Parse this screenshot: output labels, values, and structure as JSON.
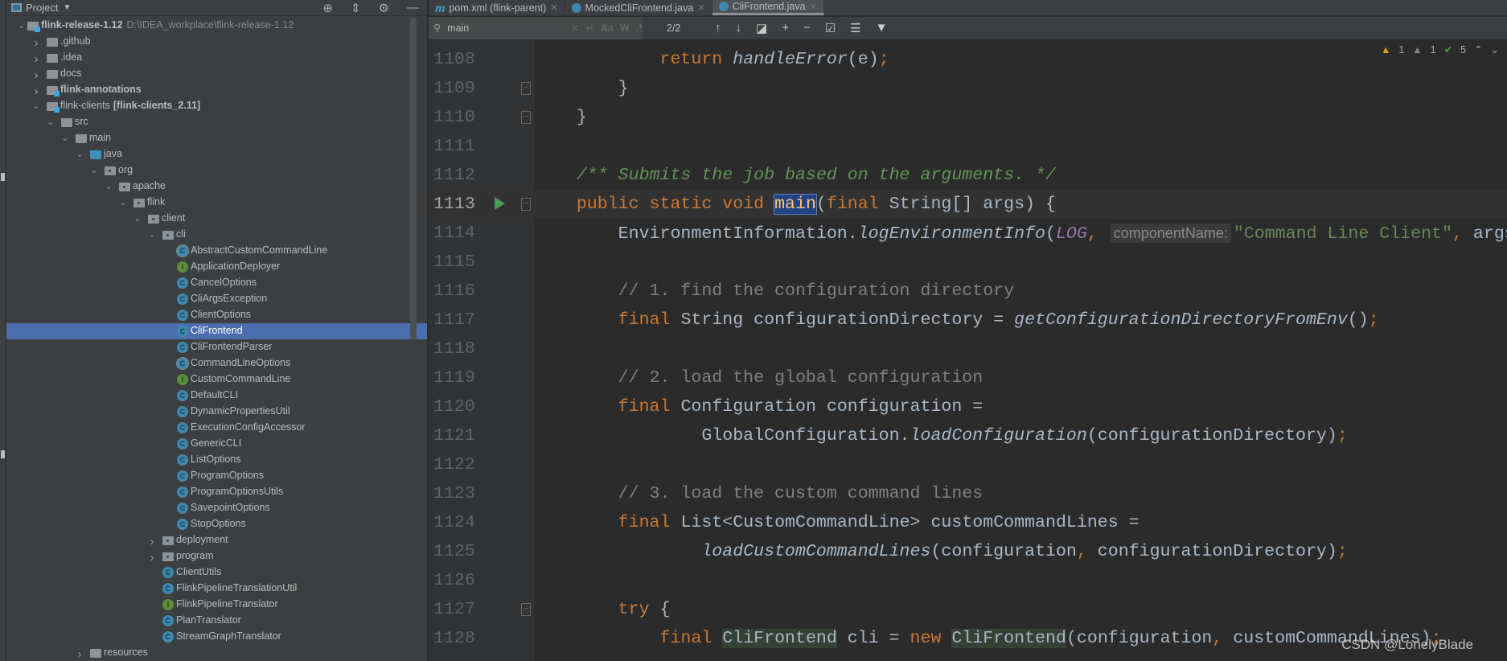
{
  "project_panel": {
    "title": "Project",
    "tools": [
      "locate-icon",
      "collapse-icon",
      "gear-icon",
      "minimize-icon"
    ],
    "tree": [
      {
        "label": "flink-release-1.12",
        "extra": "D:\\IDEA_workplace\\flink-release-1.12",
        "depth": 0,
        "kind": "module",
        "arrow": "down",
        "bold": true
      },
      {
        "label": ".github",
        "depth": 1,
        "kind": "folder",
        "arrow": "right"
      },
      {
        "label": ".idea",
        "depth": 1,
        "kind": "folder",
        "arrow": "right"
      },
      {
        "label": "docs",
        "depth": 1,
        "kind": "folder",
        "arrow": "right"
      },
      {
        "label": "flink-annotations",
        "depth": 1,
        "kind": "module",
        "arrow": "right",
        "bold": true
      },
      {
        "label": "flink-clients",
        "extra_bold": "[flink-clients_2.11]",
        "depth": 1,
        "kind": "module",
        "arrow": "down"
      },
      {
        "label": "src",
        "depth": 2,
        "kind": "folder",
        "arrow": "down"
      },
      {
        "label": "main",
        "depth": 3,
        "kind": "folder",
        "arrow": "down"
      },
      {
        "label": "java",
        "depth": 4,
        "kind": "src",
        "arrow": "down"
      },
      {
        "label": "org",
        "depth": 5,
        "kind": "pkg",
        "arrow": "down"
      },
      {
        "label": "apache",
        "depth": 6,
        "kind": "pkg",
        "arrow": "down"
      },
      {
        "label": "flink",
        "depth": 7,
        "kind": "pkg",
        "arrow": "down"
      },
      {
        "label": "client",
        "depth": 8,
        "kind": "pkg",
        "arrow": "down"
      },
      {
        "label": "cli",
        "depth": 9,
        "kind": "pkg",
        "arrow": "down"
      },
      {
        "label": "AbstractCustomCommandLine",
        "depth": 10,
        "kind": "abstract"
      },
      {
        "label": "ApplicationDeployer",
        "depth": 10,
        "kind": "interface"
      },
      {
        "label": "CancelOptions",
        "depth": 10,
        "kind": "class"
      },
      {
        "label": "CliArgsException",
        "depth": 10,
        "kind": "class"
      },
      {
        "label": "ClientOptions",
        "depth": 10,
        "kind": "class"
      },
      {
        "label": "CliFrontend",
        "depth": 10,
        "kind": "class",
        "selected": true
      },
      {
        "label": "CliFrontendParser",
        "depth": 10,
        "kind": "class"
      },
      {
        "label": "CommandLineOptions",
        "depth": 10,
        "kind": "abstract"
      },
      {
        "label": "CustomCommandLine",
        "depth": 10,
        "kind": "interface"
      },
      {
        "label": "DefaultCLI",
        "depth": 10,
        "kind": "class"
      },
      {
        "label": "DynamicPropertiesUtil",
        "depth": 10,
        "kind": "class"
      },
      {
        "label": "ExecutionConfigAccessor",
        "depth": 10,
        "kind": "class"
      },
      {
        "label": "GenericCLI",
        "depth": 10,
        "kind": "class"
      },
      {
        "label": "ListOptions",
        "depth": 10,
        "kind": "class"
      },
      {
        "label": "ProgramOptions",
        "depth": 10,
        "kind": "class"
      },
      {
        "label": "ProgramOptionsUtils",
        "depth": 10,
        "kind": "class"
      },
      {
        "label": "SavepointOptions",
        "depth": 10,
        "kind": "class"
      },
      {
        "label": "StopOptions",
        "depth": 10,
        "kind": "class"
      },
      {
        "label": "deployment",
        "depth": 9,
        "kind": "pkg",
        "arrow": "right"
      },
      {
        "label": "program",
        "depth": 9,
        "kind": "pkg",
        "arrow": "right"
      },
      {
        "label": "ClientUtils",
        "depth": 9,
        "kind": "enum"
      },
      {
        "label": "FlinkPipelineTranslationUtil",
        "depth": 9,
        "kind": "class"
      },
      {
        "label": "FlinkPipelineTranslator",
        "depth": 9,
        "kind": "interface"
      },
      {
        "label": "PlanTranslator",
        "depth": 9,
        "kind": "class"
      },
      {
        "label": "StreamGraphTranslator",
        "depth": 9,
        "kind": "class"
      },
      {
        "label": "resources",
        "depth": 4,
        "kind": "folder",
        "arrow": "right"
      }
    ]
  },
  "tabs": [
    {
      "label": "pom.xml (flink-parent)",
      "icon": "maven-icon",
      "active": false
    },
    {
      "label": "MockedCliFrontend.java",
      "icon": "class-icon",
      "active": false
    },
    {
      "label": "CliFrontend.java",
      "icon": "class-icon",
      "active": true
    }
  ],
  "search": {
    "value": "main",
    "count": "2/2",
    "case_label": "Aa",
    "word_label": "W",
    "regex_label": ".*"
  },
  "inspections": {
    "warnings": "1",
    "weak_warnings": "1",
    "typos": "5"
  },
  "code": [
    {
      "n": "1108",
      "t": [
        [
          "",
          "            "
        ],
        [
          "kw",
          "return "
        ],
        [
          "fn",
          "handleError"
        ],
        [
          "",
          "(e)"
        ],
        [
          "kw",
          ";"
        ]
      ]
    },
    {
      "n": "1109",
      "fold": true,
      "t": [
        [
          "",
          "        }"
        ]
      ]
    },
    {
      "n": "1110",
      "fold": true,
      "t": [
        [
          "",
          "    }"
        ]
      ]
    },
    {
      "n": "1111",
      "t": []
    },
    {
      "n": "1112",
      "t": [
        [
          "",
          "    "
        ],
        [
          "doc",
          "/** Submits the job based on the arguments. */"
        ]
      ]
    },
    {
      "n": "1113",
      "cur": true,
      "run": true,
      "fold": true,
      "t": [
        [
          "",
          "    "
        ],
        [
          "kw",
          "public static void "
        ],
        [
          "match",
          "main"
        ],
        [
          "",
          "("
        ],
        [
          "kw",
          "final "
        ],
        [
          "",
          "String[] args) {"
        ]
      ]
    },
    {
      "n": "1114",
      "t": [
        [
          "",
          "        EnvironmentInformation."
        ],
        [
          "fn",
          "logEnvironmentInfo"
        ],
        [
          "",
          "("
        ],
        [
          "st",
          "LOG"
        ],
        [
          "kw",
          ", "
        ],
        [
          "hint",
          "componentName:"
        ],
        [
          "str",
          "\"Command Line Client\""
        ],
        [
          "kw",
          ", "
        ],
        [
          "",
          "args);"
        ]
      ]
    },
    {
      "n": "1115",
      "t": []
    },
    {
      "n": "1116",
      "t": [
        [
          "",
          "        "
        ],
        [
          "cm",
          "// 1. find the configuration directory"
        ]
      ]
    },
    {
      "n": "1117",
      "t": [
        [
          "",
          "        "
        ],
        [
          "kw",
          "final "
        ],
        [
          "",
          "String configurationDirectory = "
        ],
        [
          "fn",
          "getConfigurationDirectoryFromEnv"
        ],
        [
          "",
          "()"
        ],
        [
          "kw",
          ";"
        ]
      ]
    },
    {
      "n": "1118",
      "t": []
    },
    {
      "n": "1119",
      "t": [
        [
          "",
          "        "
        ],
        [
          "cm",
          "// 2. load the global configuration"
        ]
      ]
    },
    {
      "n": "1120",
      "t": [
        [
          "",
          "        "
        ],
        [
          "kw",
          "final "
        ],
        [
          "",
          "Configuration configuration ="
        ]
      ]
    },
    {
      "n": "1121",
      "t": [
        [
          "",
          "                GlobalConfiguration."
        ],
        [
          "fn",
          "loadConfiguration"
        ],
        [
          "",
          "(configurationDirectory)"
        ],
        [
          "kw",
          ";"
        ]
      ]
    },
    {
      "n": "1122",
      "t": []
    },
    {
      "n": "1123",
      "t": [
        [
          "",
          "        "
        ],
        [
          "cm",
          "// 3. load the custom command lines"
        ]
      ]
    },
    {
      "n": "1124",
      "t": [
        [
          "",
          "        "
        ],
        [
          "kw",
          "final "
        ],
        [
          "",
          "List<CustomCommandLine> customCommandLines ="
        ]
      ]
    },
    {
      "n": "1125",
      "t": [
        [
          "",
          "                "
        ],
        [
          "fn",
          "loadCustomCommandLines"
        ],
        [
          "",
          "(configuration"
        ],
        [
          "kw",
          ", "
        ],
        [
          "",
          "configurationDirectory)"
        ],
        [
          "kw",
          ";"
        ]
      ]
    },
    {
      "n": "1126",
      "t": []
    },
    {
      "n": "1127",
      "fold": true,
      "t": [
        [
          "",
          "        "
        ],
        [
          "kw",
          "try "
        ],
        [
          "",
          "{"
        ]
      ]
    },
    {
      "n": "1128",
      "t": [
        [
          "",
          "            "
        ],
        [
          "kw",
          "final "
        ],
        [
          "use",
          "CliFrontend"
        ],
        [
          "",
          " cli = "
        ],
        [
          "kw",
          "new "
        ],
        [
          "use",
          "CliFrontend"
        ],
        [
          "",
          "(configuration"
        ],
        [
          "kw",
          ", "
        ],
        [
          "",
          "customCommandLines)"
        ],
        [
          "kw",
          ";"
        ]
      ]
    }
  ],
  "watermark": "CSDN @LonelyBlade"
}
